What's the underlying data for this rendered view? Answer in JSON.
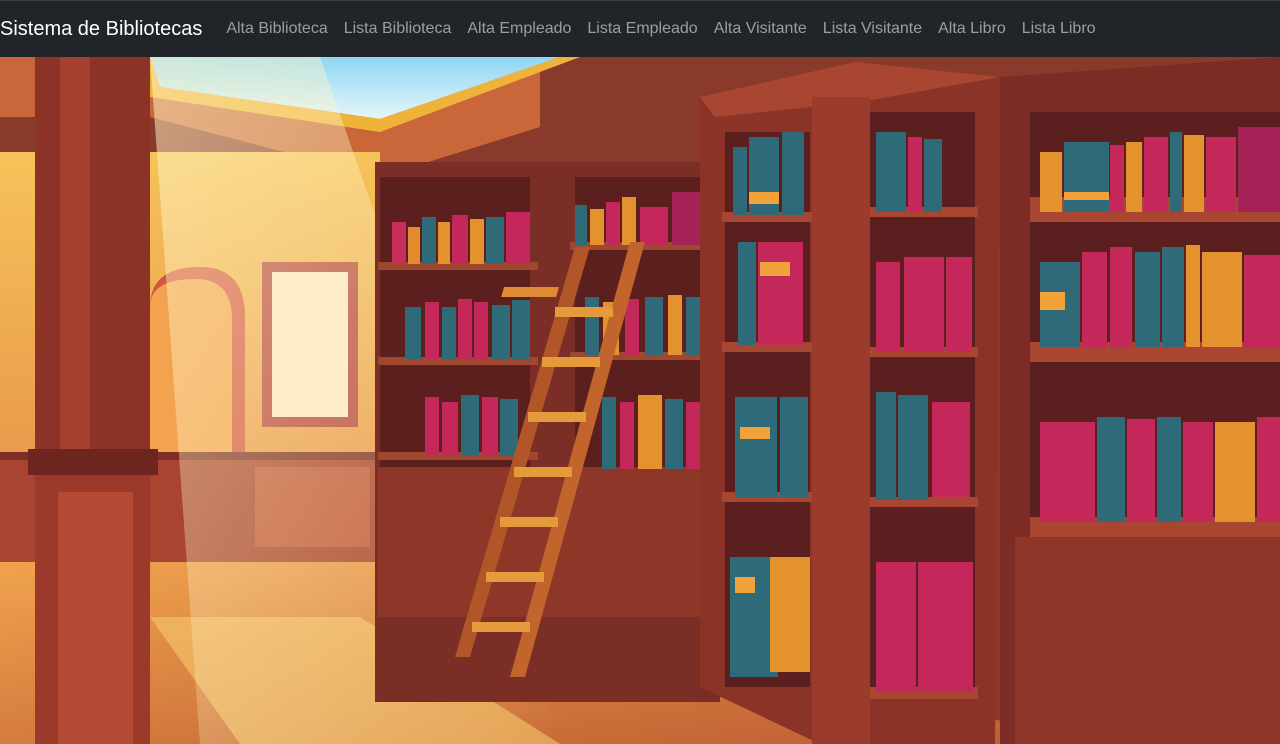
{
  "navbar": {
    "brand": "Sistema de Bibliotecas",
    "links": [
      {
        "label": "Alta Biblioteca"
      },
      {
        "label": "Lista Biblioteca"
      },
      {
        "label": "Alta Empleado"
      },
      {
        "label": "Lista Empleado"
      },
      {
        "label": "Alta Visitante"
      },
      {
        "label": "Lista Visitante"
      },
      {
        "label": "Alta Libro"
      },
      {
        "label": "Lista Libro"
      }
    ]
  },
  "colors": {
    "navbar_bg": "#212529",
    "brand_text": "#ffffff",
    "link_text": "rgba(255,255,255,0.55)"
  }
}
